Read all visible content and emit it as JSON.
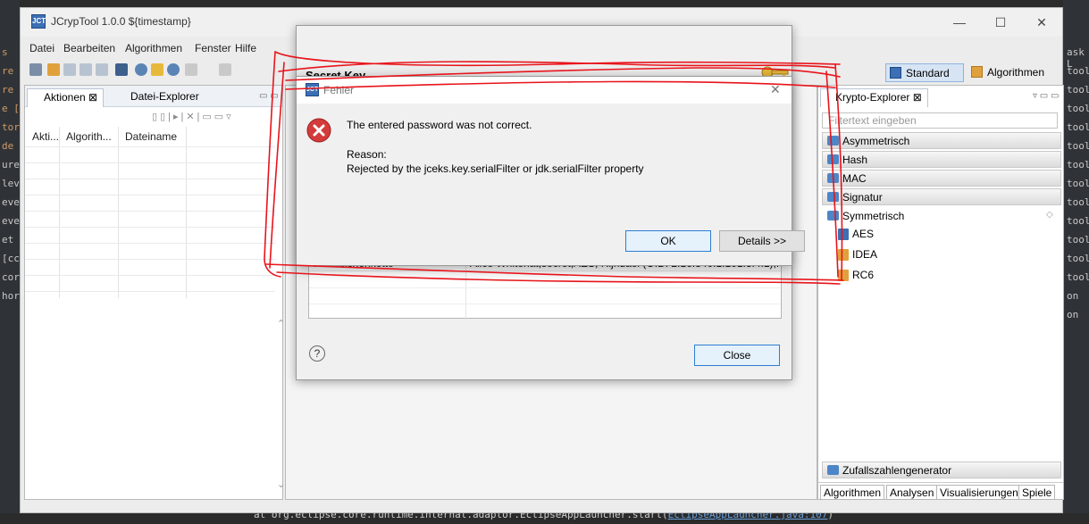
{
  "console": {
    "line_prefix": "at org.eclipse.core.runtime.internal.adaptor.EclipseAppLauncher.start(",
    "line_link": "EclipseAppLauncher.java:107",
    "line_suffix": ")"
  },
  "side_fragments": {
    "left": [
      "s",
      "re",
      "re",
      "e [",
      "tor",
      "de",
      "ure",
      "lev",
      "eve",
      "eve",
      "et",
      "[cc",
      "cor",
      "hor"
    ],
    "right": [
      "ask L",
      "tool.",
      "tool.",
      "tool.",
      "tool.",
      "tool.",
      "tool.",
      "tool.",
      "tool.",
      "tool.",
      "tool.",
      "tool.",
      "tool.",
      "on",
      "on"
    ]
  },
  "window": {
    "title": "JCrypTool 1.0.0 ${timestamp}",
    "icon_text": "JCT",
    "controls": [
      "—",
      "☐",
      "✕"
    ]
  },
  "menu": [
    "Datei",
    "Bearbeiten",
    "Algorithmen",
    "Fenster",
    "Hilfe"
  ],
  "perspectives": {
    "standard": "Standard",
    "algorithms": "Algorithmen"
  },
  "left_panel": {
    "tabs": [
      "Aktionen ⊠",
      "Datei-Explorer"
    ],
    "columns": [
      "Akti...",
      "Algorith...",
      "Dateiname"
    ]
  },
  "secret_dialog": {
    "title": "Secret Key",
    "table_row": {
      "label": "Als Zeichenkette",
      "value": "Alice Whitehat,secret,AES, Rijndael (OID: 2.16.840.1.101.3.4.1),..."
    },
    "help": "?",
    "close_label": "Close"
  },
  "error_dialog": {
    "title": "Fehler",
    "message": "The entered password was not correct.",
    "reason_label": "Reason:",
    "reason": "Rejected by the jceks.key.serialFilter or jdk.serialFilter property",
    "ok_label": "OK",
    "details_label": "Details >>"
  },
  "right_panel": {
    "tab": "Krypto-Explorer ⊠",
    "filter_placeholder": "Filtertext eingeben",
    "categories": [
      "Asymmetrisch",
      "Hash",
      "MAC",
      "Signatur",
      "Symmetrisch"
    ],
    "leaves": [
      "AES",
      "IDEA",
      "RC6"
    ],
    "bottom_category": "Zufallszahlengenerator",
    "bottom_tabs": [
      "Algorithmen",
      "Analysen",
      "Visualisierungen",
      "Spiele"
    ]
  },
  "colors": {
    "annotation_red": "#e8141b",
    "accent_blue": "#2d7fd2",
    "error_red": "#d43b3b"
  }
}
